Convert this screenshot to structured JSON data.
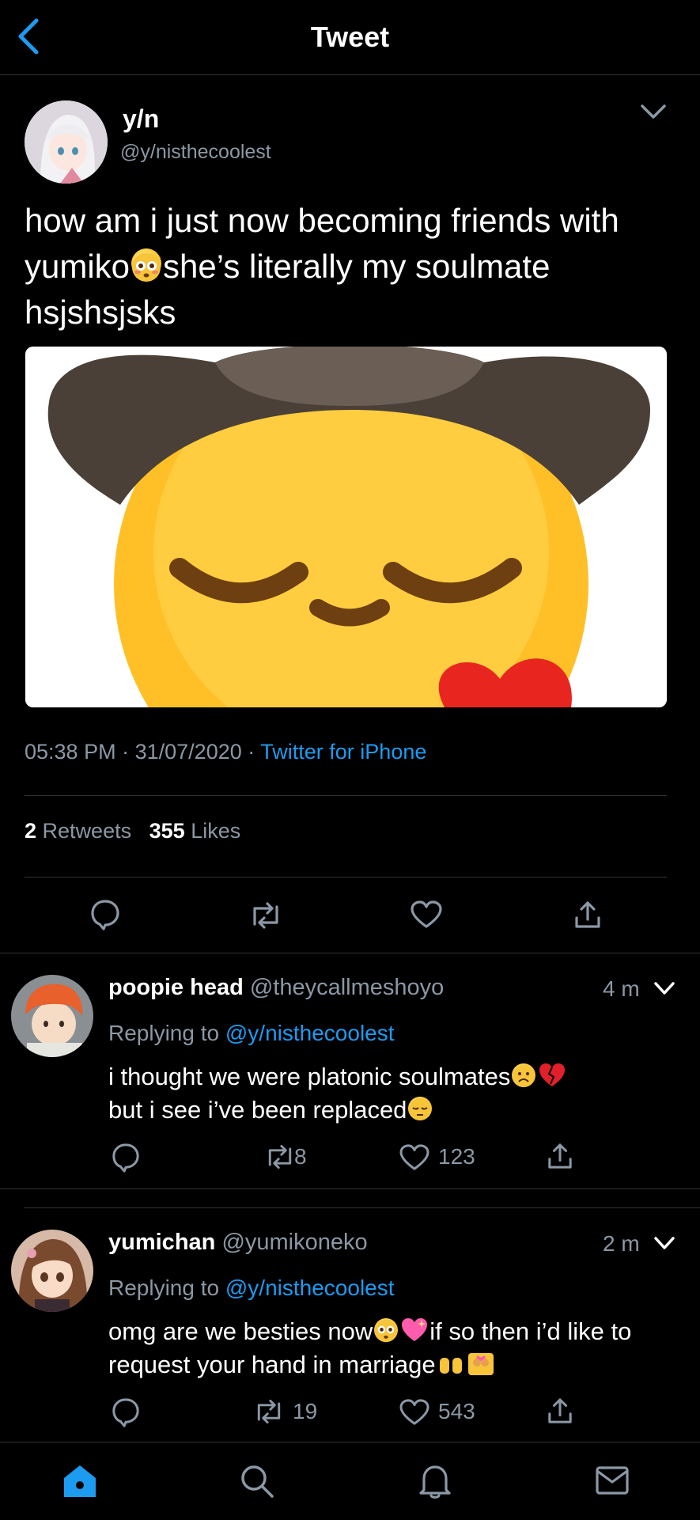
{
  "header": {
    "title": "Tweet",
    "back_icon": "chevron-left-icon"
  },
  "colors": {
    "accent": "#1d9bf0",
    "muted": "#8b98a5",
    "divider": "#2f3336"
  },
  "tweet": {
    "author_name": "y/n",
    "author_handle": "@y/nisthecoolest",
    "text_part1": "how am i just now becoming friends with yumiko",
    "text_part2": "she’s literally my soulmate hsjshsjsks",
    "emoji1": "flushed-face-emoji",
    "time": "05:38 PM",
    "sep1": "·",
    "date": "31/07/2020",
    "sep2": "·",
    "source": "Twitter for iPhone",
    "retweets_count": "2",
    "retweets_label": "Retweets",
    "likes_count": "355",
    "likes_label": "Likes",
    "image": "cowboy-pleading-emoji-image"
  },
  "replies": [
    {
      "name": "poopie head",
      "handle": "@theycallmeshoyo",
      "time": "4 m",
      "replying_label": "Replying to",
      "replying_handle": "@y/nisthecoolest",
      "text_part1": "i thought we were platonic soulmates",
      "text_part2": "but i see i’ve been replaced",
      "retweets": "8",
      "likes": "123"
    },
    {
      "name": "yumichan",
      "handle": "@yumikoneko",
      "time": "2 m",
      "replying_label": "Replying to",
      "replying_handle": "@y/nisthecoolest",
      "text_part1": "omg are we besties now",
      "text_part2": "if so then i’d like to request your hand in marriage",
      "retweets": "19",
      "likes": "543"
    }
  ],
  "tabbar": {
    "items": [
      "home-icon",
      "search-icon",
      "notifications-icon",
      "messages-icon"
    ]
  }
}
